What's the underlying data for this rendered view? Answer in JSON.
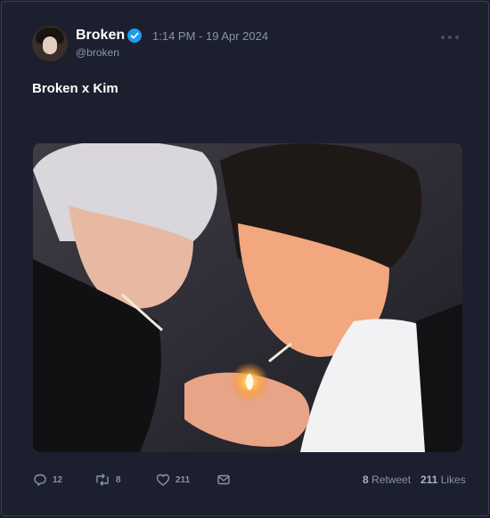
{
  "tweet": {
    "author_name": "Broken",
    "handle": "@broken",
    "timestamp": "1:14 PM - 19 Apr 2024",
    "text": "Broken x Kim",
    "verified_icon": "verified-badge-icon"
  },
  "actions": {
    "reply_count": "12",
    "retweet_count": "8",
    "like_count": "211",
    "icons": [
      "reply-icon",
      "retweet-icon",
      "like-icon",
      "message-icon"
    ]
  },
  "stats": {
    "retweets_value": "8",
    "retweets_label": "Retweet",
    "likes_value": "211",
    "likes_label": "Likes"
  },
  "colors": {
    "background": "#1c1f2d",
    "verified": "#1d9bf0",
    "muted_text": "#8b93a8"
  }
}
